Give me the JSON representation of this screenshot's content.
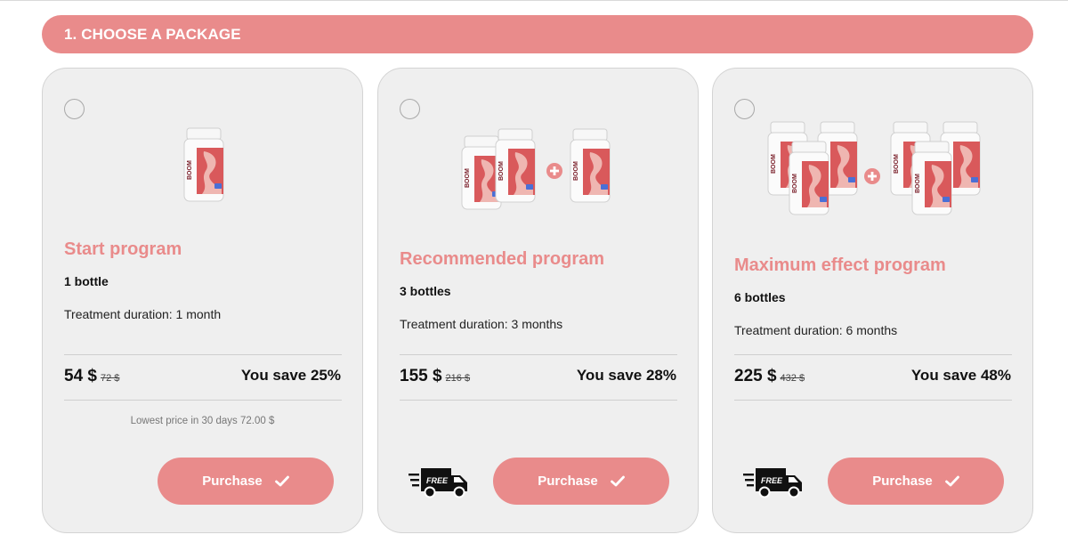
{
  "section": {
    "title": "1. CHOOSE A PACKAGE"
  },
  "packages": [
    {
      "title": "Start program",
      "quantity": "1 bottle",
      "duration": "Treatment duration: 1 month",
      "price": "54 $",
      "old_price": "72 $",
      "savings": "You save 25%",
      "lowest_price_note": "Lowest price in 30 days 72.00 $",
      "button": "Purchase",
      "free_shipping": false
    },
    {
      "title": "Recommended program",
      "quantity": "3 bottles",
      "duration": "Treatment duration: 3 months",
      "price": "155 $",
      "old_price": "216 $",
      "savings": "You save 28%",
      "button": "Purchase",
      "free_shipping": true,
      "badge": "FREE"
    },
    {
      "title": "Maximum effect program",
      "quantity": "6 bottles",
      "duration": "Treatment duration: 6 months",
      "price": "225 $",
      "old_price": "432 $",
      "savings": "You save 48%",
      "button": "Purchase",
      "free_shipping": true,
      "badge": "FREE"
    }
  ],
  "product": {
    "label": "BOOM"
  },
  "colors": {
    "accent": "#e98b8b",
    "card_bg": "#efefef",
    "plus_circle": "#e98b8b"
  },
  "icons": {
    "button": "check-icon",
    "shipping": "delivery-truck-icon",
    "select": "radio-icon"
  }
}
